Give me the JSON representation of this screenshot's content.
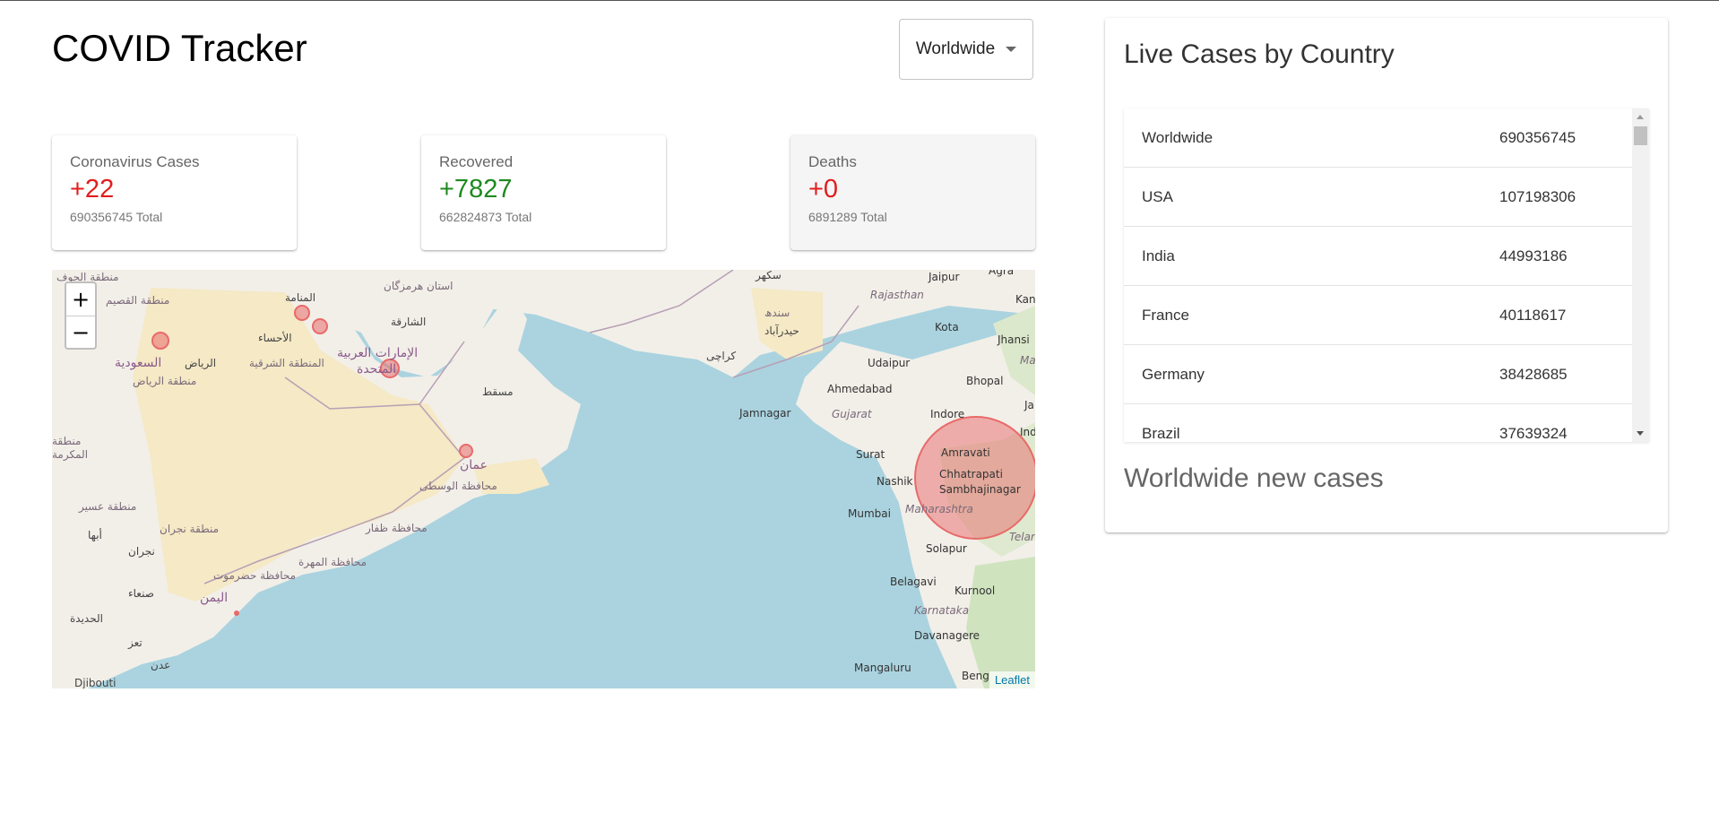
{
  "app": {
    "title": "COVID Tracker"
  },
  "country_select": {
    "value": "Worldwide"
  },
  "stats": [
    {
      "label": "Coronavirus Cases",
      "value": "+22",
      "total": "690356745 Total",
      "color": "#e21d1d"
    },
    {
      "label": "Recovered",
      "value": "+7827",
      "total": "662824873 Total",
      "color": "#1e8a1e"
    },
    {
      "label": "Deaths",
      "value": "+0",
      "total": "6891289 Total",
      "color": "#e21d1d"
    }
  ],
  "map": {
    "zoom_in": "+",
    "zoom_out": "−",
    "attribution": "Leaflet",
    "labels": {
      "saudi": "السعودية",
      "riyadh": "الرياض",
      "riyadh_region": "منطقة الرياض",
      "qassim": "منطقة القصيم",
      "jawf": "منطقة الجوف",
      "manama": "المنامة",
      "ahsa": "الأحساء",
      "eastern": "المنطقة الشرقية",
      "uae": "الإمارات العربية",
      "uae2": "المتحدة",
      "sharjah": "الشارقة",
      "hormozgan": "استان هرمزگان",
      "muscat": "مسقط",
      "oman": "عمان",
      "wusta": "محافظة الوسطى",
      "dhofar": "محافظة ظفار",
      "mahra": "محافظة المهرة",
      "hadramawt": "محافظة حضرموت",
      "yemen": "اليمن",
      "sanaa": "صنعاء",
      "najran": "منطقة نجران",
      "najran_city": "نجران",
      "asir": "منطقة عسير",
      "abha": "أبها",
      "hudaydah": "الحديدة",
      "taiz": "تعز",
      "aden": "عدن",
      "djibouti": "Djibouti",
      "makkah": "منطقة",
      "makkah2": "المكرمة",
      "sukkur": "سکھر",
      "sindh": "سندھ",
      "hyderabad": "حیدرآباد",
      "karachi": "کراچی",
      "jaipur": "Jaipur",
      "agra": "Agra",
      "rajasthan": "Rajasthan",
      "kota": "Kota",
      "jhansi": "Jhansi",
      "udaipur": "Udaipur",
      "ahmedabad": "Ahmedabad",
      "bhopal": "Bhopal",
      "gujarat": "Gujarat",
      "jamnagar": "Jamnagar",
      "indore": "Indore",
      "surat": "Surat",
      "amravati": "Amravati",
      "nashik": "Nashik",
      "chhatrapati": "Chhatrapati",
      "sambhajinagar": "Sambhajinagar",
      "maharashtra": "Maharashtra",
      "mumbai": "Mumbai",
      "solapur": "Solapur",
      "belagavi": "Belagavi",
      "kurnool": "Kurnool",
      "karnataka": "Karnataka",
      "davanagere": "Davanagere",
      "mangaluru": "Mangaluru",
      "beng": "Beng",
      "telan": "Telan",
      "kan": "Kan",
      "ind": "Ind",
      "ma": "Ma",
      "ja": "Ja"
    }
  },
  "live_cases": {
    "title": "Live Cases by Country",
    "rows": [
      {
        "country": "Worldwide",
        "cases": "690356745"
      },
      {
        "country": "USA",
        "cases": "107198306"
      },
      {
        "country": "India",
        "cases": "44993186"
      },
      {
        "country": "France",
        "cases": "40118617"
      },
      {
        "country": "Germany",
        "cases": "38428685"
      },
      {
        "country": "Brazil",
        "cases": "37639324"
      }
    ]
  },
  "chart": {
    "title": "Worldwide new cases"
  }
}
